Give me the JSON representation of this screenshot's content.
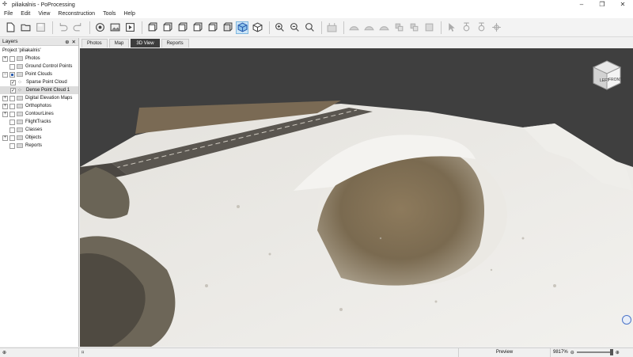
{
  "window": {
    "title": "piliakalnis - PoProcessing"
  },
  "menu": [
    "File",
    "Edit",
    "View",
    "Reconstruction",
    "Tools",
    "Help"
  ],
  "toolbar": {
    "icons": [
      "new-file-icon",
      "open-folder-icon",
      "save-icon",
      "undo-icon",
      "redo-icon",
      "camera-icon",
      "image-icon",
      "play-icon",
      "view-front-icon",
      "view-back-icon",
      "view-left-icon",
      "view-right-icon",
      "view-top-icon",
      "view-bottom-icon",
      "view-iso-icon",
      "view-perspective-icon",
      "zoom-in-icon",
      "zoom-out-icon",
      "zoom-fit-icon",
      "measure-icon",
      "surface-1-icon",
      "surface-2-icon",
      "surface-3-icon",
      "surface-4-icon",
      "surface-5-icon",
      "surface-6-icon",
      "select-icon",
      "marker-1-icon",
      "marker-2-icon",
      "marker-3-icon"
    ]
  },
  "layers_panel": {
    "title": "Layers",
    "items": [
      {
        "label": "Project 'piliakalnis'",
        "level": 0,
        "expander": "",
        "checkbox": "none",
        "icon": "none"
      },
      {
        "label": "Photos",
        "level": 0,
        "expander": "+",
        "checkbox": "empty",
        "icon": "folder"
      },
      {
        "label": "Ground Control Points",
        "level": 0,
        "expander": "",
        "checkbox": "empty",
        "icon": "folder"
      },
      {
        "label": "Point Clouds",
        "level": 0,
        "expander": "−",
        "checkbox": "partial",
        "icon": "folder"
      },
      {
        "label": "Sparse Point Cloud",
        "level": 1,
        "expander": "",
        "checkbox": "checked",
        "icon": "points"
      },
      {
        "label": "Dense Point Cloud 1",
        "level": 1,
        "expander": "",
        "checkbox": "checked",
        "icon": "points",
        "selected": true
      },
      {
        "label": "Digital Elevation Maps",
        "level": 0,
        "expander": "+",
        "checkbox": "empty",
        "icon": "folder"
      },
      {
        "label": "Orthophotos",
        "level": 0,
        "expander": "+",
        "checkbox": "empty",
        "icon": "folder"
      },
      {
        "label": "ContourLines",
        "level": 0,
        "expander": "+",
        "checkbox": "empty",
        "icon": "folder"
      },
      {
        "label": "FlightTracks",
        "level": 0,
        "expander": "",
        "checkbox": "empty",
        "icon": "folder"
      },
      {
        "label": "Classes",
        "level": 0,
        "expander": "",
        "checkbox": "empty",
        "icon": "folder"
      },
      {
        "label": "Objects",
        "level": 0,
        "expander": "+",
        "checkbox": "empty",
        "icon": "folder"
      },
      {
        "label": "Reports",
        "level": 0,
        "expander": "",
        "checkbox": "empty",
        "icon": "folder"
      }
    ]
  },
  "tabs": [
    {
      "label": "Photos",
      "active": false
    },
    {
      "label": "Map",
      "active": false
    },
    {
      "label": "3D View",
      "active": true
    },
    {
      "label": "Reports",
      "active": false
    }
  ],
  "navcube": {
    "left_face": "LEFT",
    "front_face": "FRONT"
  },
  "status": {
    "mode": "Preview",
    "zoom": "9817%"
  },
  "colors": {
    "accent": "#2a5db0",
    "viewport_bg": "#3f3f3f",
    "active_tab": "#3d3d3d"
  }
}
